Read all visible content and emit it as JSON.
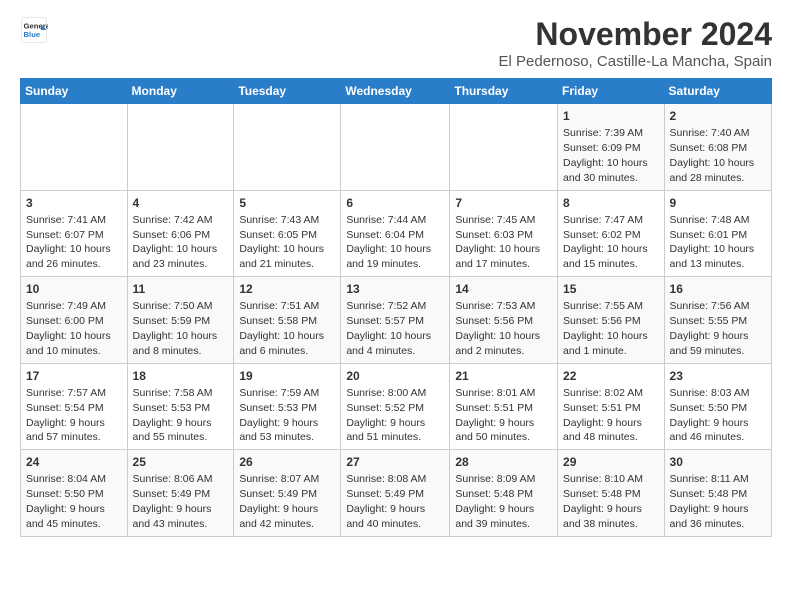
{
  "header": {
    "logo_line1": "General",
    "logo_line2": "Blue",
    "month_title": "November 2024",
    "location": "El Pedernoso, Castille-La Mancha, Spain"
  },
  "days_of_week": [
    "Sunday",
    "Monday",
    "Tuesday",
    "Wednesday",
    "Thursday",
    "Friday",
    "Saturday"
  ],
  "weeks": [
    [
      {
        "day": "",
        "info": ""
      },
      {
        "day": "",
        "info": ""
      },
      {
        "day": "",
        "info": ""
      },
      {
        "day": "",
        "info": ""
      },
      {
        "day": "",
        "info": ""
      },
      {
        "day": "1",
        "info": "Sunrise: 7:39 AM\nSunset: 6:09 PM\nDaylight: 10 hours and 30 minutes."
      },
      {
        "day": "2",
        "info": "Sunrise: 7:40 AM\nSunset: 6:08 PM\nDaylight: 10 hours and 28 minutes."
      }
    ],
    [
      {
        "day": "3",
        "info": "Sunrise: 7:41 AM\nSunset: 6:07 PM\nDaylight: 10 hours and 26 minutes."
      },
      {
        "day": "4",
        "info": "Sunrise: 7:42 AM\nSunset: 6:06 PM\nDaylight: 10 hours and 23 minutes."
      },
      {
        "day": "5",
        "info": "Sunrise: 7:43 AM\nSunset: 6:05 PM\nDaylight: 10 hours and 21 minutes."
      },
      {
        "day": "6",
        "info": "Sunrise: 7:44 AM\nSunset: 6:04 PM\nDaylight: 10 hours and 19 minutes."
      },
      {
        "day": "7",
        "info": "Sunrise: 7:45 AM\nSunset: 6:03 PM\nDaylight: 10 hours and 17 minutes."
      },
      {
        "day": "8",
        "info": "Sunrise: 7:47 AM\nSunset: 6:02 PM\nDaylight: 10 hours and 15 minutes."
      },
      {
        "day": "9",
        "info": "Sunrise: 7:48 AM\nSunset: 6:01 PM\nDaylight: 10 hours and 13 minutes."
      }
    ],
    [
      {
        "day": "10",
        "info": "Sunrise: 7:49 AM\nSunset: 6:00 PM\nDaylight: 10 hours and 10 minutes."
      },
      {
        "day": "11",
        "info": "Sunrise: 7:50 AM\nSunset: 5:59 PM\nDaylight: 10 hours and 8 minutes."
      },
      {
        "day": "12",
        "info": "Sunrise: 7:51 AM\nSunset: 5:58 PM\nDaylight: 10 hours and 6 minutes."
      },
      {
        "day": "13",
        "info": "Sunrise: 7:52 AM\nSunset: 5:57 PM\nDaylight: 10 hours and 4 minutes."
      },
      {
        "day": "14",
        "info": "Sunrise: 7:53 AM\nSunset: 5:56 PM\nDaylight: 10 hours and 2 minutes."
      },
      {
        "day": "15",
        "info": "Sunrise: 7:55 AM\nSunset: 5:56 PM\nDaylight: 10 hours and 1 minute."
      },
      {
        "day": "16",
        "info": "Sunrise: 7:56 AM\nSunset: 5:55 PM\nDaylight: 9 hours and 59 minutes."
      }
    ],
    [
      {
        "day": "17",
        "info": "Sunrise: 7:57 AM\nSunset: 5:54 PM\nDaylight: 9 hours and 57 minutes."
      },
      {
        "day": "18",
        "info": "Sunrise: 7:58 AM\nSunset: 5:53 PM\nDaylight: 9 hours and 55 minutes."
      },
      {
        "day": "19",
        "info": "Sunrise: 7:59 AM\nSunset: 5:53 PM\nDaylight: 9 hours and 53 minutes."
      },
      {
        "day": "20",
        "info": "Sunrise: 8:00 AM\nSunset: 5:52 PM\nDaylight: 9 hours and 51 minutes."
      },
      {
        "day": "21",
        "info": "Sunrise: 8:01 AM\nSunset: 5:51 PM\nDaylight: 9 hours and 50 minutes."
      },
      {
        "day": "22",
        "info": "Sunrise: 8:02 AM\nSunset: 5:51 PM\nDaylight: 9 hours and 48 minutes."
      },
      {
        "day": "23",
        "info": "Sunrise: 8:03 AM\nSunset: 5:50 PM\nDaylight: 9 hours and 46 minutes."
      }
    ],
    [
      {
        "day": "24",
        "info": "Sunrise: 8:04 AM\nSunset: 5:50 PM\nDaylight: 9 hours and 45 minutes."
      },
      {
        "day": "25",
        "info": "Sunrise: 8:06 AM\nSunset: 5:49 PM\nDaylight: 9 hours and 43 minutes."
      },
      {
        "day": "26",
        "info": "Sunrise: 8:07 AM\nSunset: 5:49 PM\nDaylight: 9 hours and 42 minutes."
      },
      {
        "day": "27",
        "info": "Sunrise: 8:08 AM\nSunset: 5:49 PM\nDaylight: 9 hours and 40 minutes."
      },
      {
        "day": "28",
        "info": "Sunrise: 8:09 AM\nSunset: 5:48 PM\nDaylight: 9 hours and 39 minutes."
      },
      {
        "day": "29",
        "info": "Sunrise: 8:10 AM\nSunset: 5:48 PM\nDaylight: 9 hours and 38 minutes."
      },
      {
        "day": "30",
        "info": "Sunrise: 8:11 AM\nSunset: 5:48 PM\nDaylight: 9 hours and 36 minutes."
      }
    ]
  ]
}
